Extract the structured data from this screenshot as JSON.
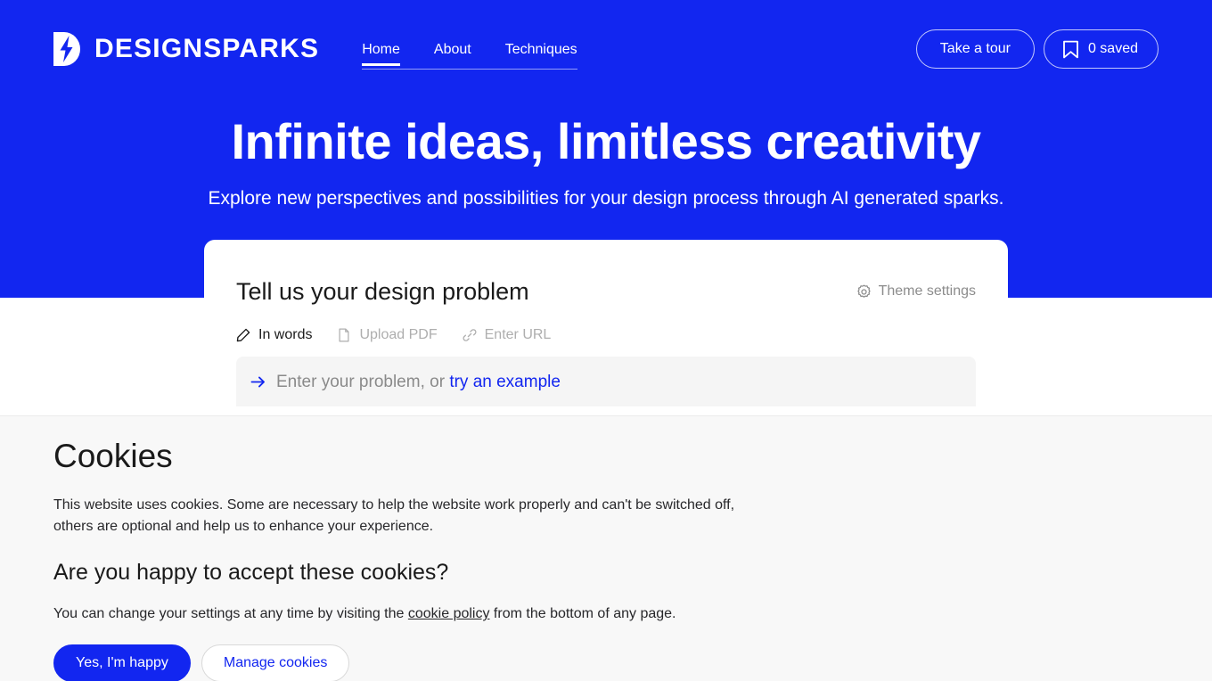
{
  "theme": {
    "brand_blue": "#1226f0",
    "page_bg": "#ffffff",
    "banner_bg": "#f8f8f8",
    "input_bg": "#f5f5f5"
  },
  "header": {
    "brand_name": "DESIGNSPARKS",
    "logo_icon": "lightning-bolt-logo-icon",
    "nav": [
      {
        "label": "Home",
        "active": true
      },
      {
        "label": "About",
        "active": false
      },
      {
        "label": "Techniques",
        "active": false
      }
    ],
    "tour_button": "Take a tour",
    "saved_button": "0 saved",
    "saved_icon": "bookmark-icon"
  },
  "hero": {
    "title": "Infinite ideas, limitless creativity",
    "subtitle": "Explore new perspectives and possibilities for your design process through AI generated sparks."
  },
  "card": {
    "title": "Tell us your design problem",
    "theme_settings_label": "Theme settings",
    "theme_settings_icon": "gear-icon",
    "modes": [
      {
        "label": "In words",
        "icon": "pencil-icon",
        "active": true
      },
      {
        "label": "Upload PDF",
        "icon": "document-icon",
        "active": false
      },
      {
        "label": "Enter URL",
        "icon": "link-icon",
        "active": false
      }
    ],
    "input": {
      "icon": "arrow-right-icon",
      "placeholder_prefix": "Enter your problem, or ",
      "example_link": "try an example",
      "value": ""
    }
  },
  "cookie_banner": {
    "title": "Cookies",
    "body": "This website uses cookies. Some are necessary to help the website work properly and can't be switched off, others are optional and help us to enhance your experience.",
    "question": "Are you happy to accept these cookies?",
    "note_prefix": "You can change your settings at any time by visiting the ",
    "note_link": "cookie policy",
    "note_suffix": " from the bottom of any page.",
    "accept_button": "Yes, I'm happy",
    "manage_button": "Manage cookies"
  }
}
